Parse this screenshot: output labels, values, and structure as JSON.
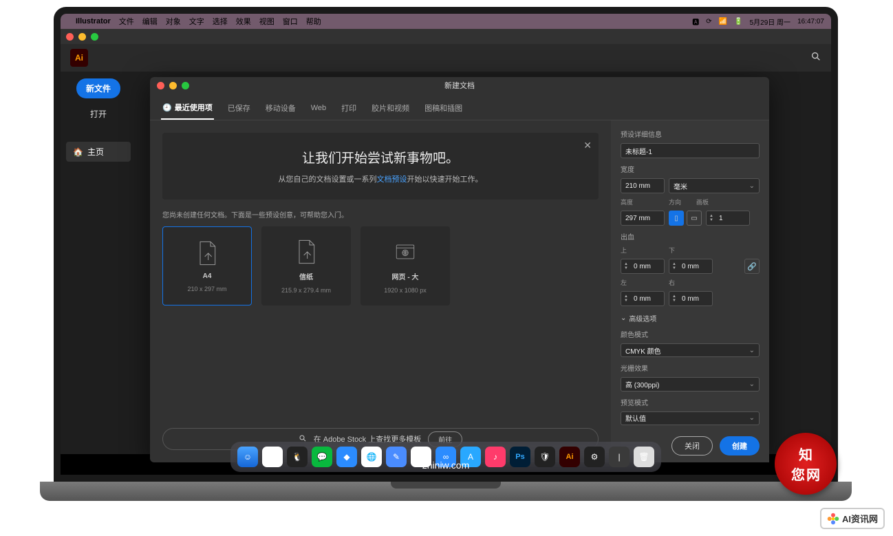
{
  "menubar": {
    "app": "Illustrator",
    "items": [
      "文件",
      "编辑",
      "对象",
      "文字",
      "选择",
      "效果",
      "视图",
      "窗口",
      "帮助"
    ],
    "date": "5月29日 周一",
    "time": "16:47:07"
  },
  "leftnav": {
    "new": "新文件",
    "open": "打开",
    "home": "主页"
  },
  "topbar": {
    "ai": "Ai"
  },
  "dialog": {
    "title": "新建文档",
    "tabs": [
      "最近使用项",
      "已保存",
      "移动设备",
      "Web",
      "打印",
      "胶片和视频",
      "图稿和插图"
    ],
    "hero_title": "让我们开始尝试新事物吧。",
    "hero_text1": "从您自己的文档设置或一系列",
    "hero_link": "文档预设",
    "hero_text2": "开始以快速开始工作。",
    "hint": "您尚未创建任何文档。下面是一些预设创意，可帮助您入门。",
    "presets": [
      {
        "name": "A4",
        "size": "210 x 297 mm",
        "type": "doc"
      },
      {
        "name": "信纸",
        "size": "215.9 x 279.4 mm",
        "type": "doc"
      },
      {
        "name": "网页 - 大",
        "size": "1920 x 1080 px",
        "type": "web"
      }
    ],
    "stock_text": "在 Adobe Stock 上查找更多模板",
    "stock_go": "前往"
  },
  "panel": {
    "header": "预设详细信息",
    "doc_name": "未标题-1",
    "width_label": "宽度",
    "width": "210 mm",
    "unit": "毫米",
    "height_label": "高度",
    "height": "297 mm",
    "orient_label": "方向",
    "artboard_label": "画板",
    "artboard": "1",
    "bleed_label": "出血",
    "top": "上",
    "bottom": "下",
    "left": "左",
    "right": "右",
    "bleed_val": "0 mm",
    "advanced": "高级选项",
    "color_mode_label": "颜色模式",
    "color_mode": "CMYK 颜色",
    "raster_label": "光栅效果",
    "raster": "高 (300ppi)",
    "preview_label": "预览模式",
    "preview": "默认值",
    "close": "关闭",
    "create": "创建"
  },
  "footer": {
    "url": "zhiniw.com",
    "badge": "AI资讯网"
  },
  "seal": {
    "c1": "知",
    "c2": "您",
    "c3": "网"
  }
}
